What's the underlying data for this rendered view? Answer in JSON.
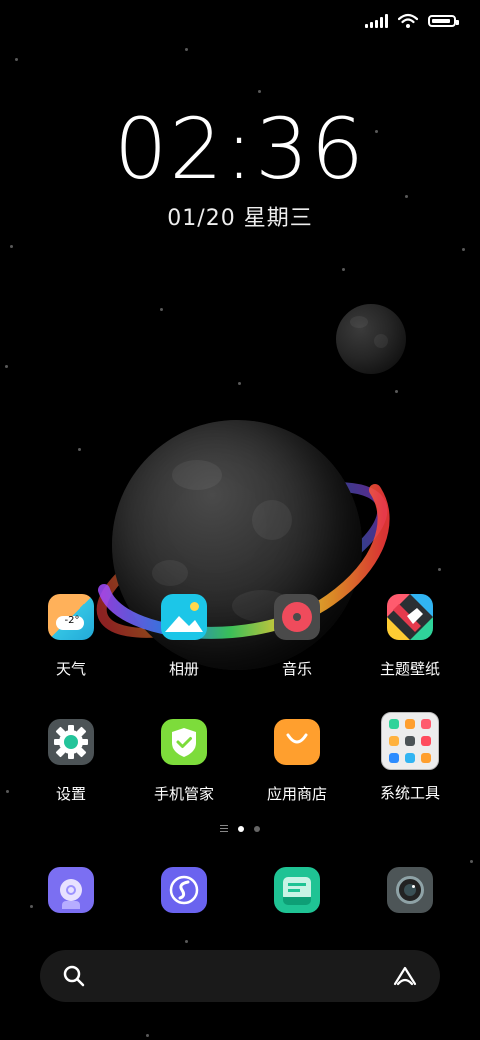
{
  "status_bar": {
    "signal": "signal-icon",
    "wifi": "wifi-icon",
    "battery_level": 0.9
  },
  "lockscreen": {
    "hours": "02",
    "minutes": "36",
    "date": "01/20 星期三"
  },
  "page1": {
    "apps": [
      {
        "label": "天气",
        "icon": "weather-icon",
        "temp": "-2°"
      },
      {
        "label": "相册",
        "icon": "gallery-icon"
      },
      {
        "label": "音乐",
        "icon": "music-icon"
      },
      {
        "label": "主题壁纸",
        "icon": "themes-icon"
      },
      {
        "label": "设置",
        "icon": "settings-icon"
      },
      {
        "label": "手机管家",
        "icon": "security-icon"
      },
      {
        "label": "应用商店",
        "icon": "app-store-icon"
      },
      {
        "label": "系统工具",
        "icon": "folder-icon"
      }
    ]
  },
  "page_indicator": {
    "pages": 2,
    "current": 1
  },
  "dock": {
    "apps": [
      {
        "icon": "compass-app-icon"
      },
      {
        "icon": "browser-app-icon"
      },
      {
        "icon": "messages-app-icon"
      },
      {
        "icon": "camera-app-icon"
      }
    ]
  },
  "search": {
    "placeholder": "",
    "left_icon": "search-icon",
    "right_icon": "assistant-icon"
  },
  "colors": {
    "weather_bg": "#2cb8d8",
    "gallery_bg": "#1cc6e8",
    "music_bg": "#4a4a4a",
    "music_accent": "#ef4b5c",
    "settings_bg": "#4c5356",
    "security_bg": "#7ddc3b",
    "store_bg": "#ff9f2e",
    "dock_compass": "#7b6ff2",
    "dock_browser": "#6a63ef",
    "dock_messages": "#1fc394",
    "dock_camera": "#4d5557"
  }
}
